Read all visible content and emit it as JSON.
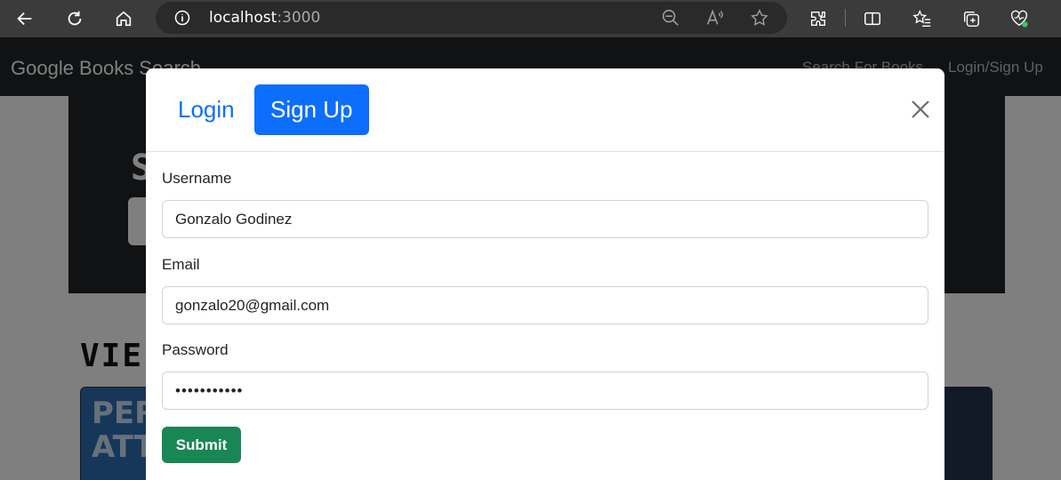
{
  "browser": {
    "url_host": "localhost",
    "url_port": ":3000"
  },
  "navbar": {
    "brand": "Google Books Search",
    "links": [
      "Search For Books",
      "Login/Sign Up"
    ]
  },
  "hero": {
    "heading": "S"
  },
  "section": {
    "heading": "VIE"
  },
  "card": {
    "left_text": "PER\nATTA"
  },
  "modal": {
    "tabs": [
      "Login",
      "Sign Up"
    ],
    "active_tab": "Sign Up",
    "fields": {
      "username_label": "Username",
      "username_value": "Gonzalo Godinez",
      "email_label": "Email",
      "email_value": "gonzalo20@gmail.com",
      "password_label": "Password",
      "password_value": "•••••••••••"
    },
    "submit_label": "Submit"
  },
  "colors": {
    "primary": "#0d6efd",
    "success": "#198754",
    "navbar_bg": "#212529",
    "chrome_bg": "#3b3b3b"
  }
}
